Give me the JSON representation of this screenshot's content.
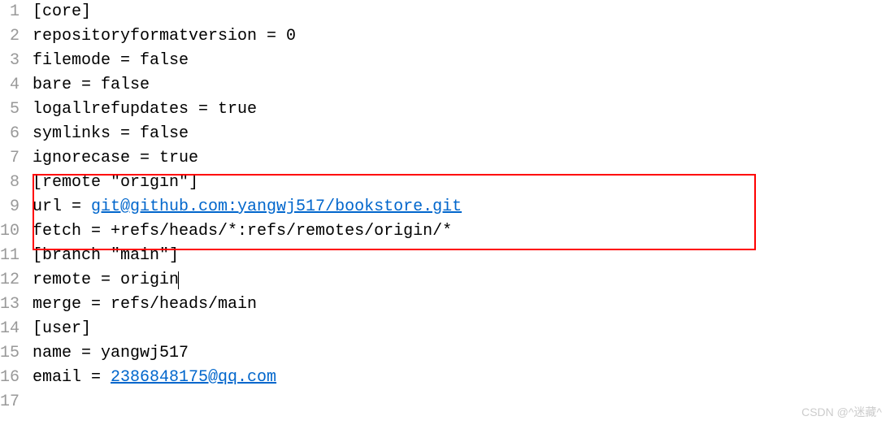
{
  "lines": [
    {
      "num": "1",
      "indent": "",
      "text": "[core]"
    },
    {
      "num": "2",
      "indent": "        ",
      "text": "repositoryformatversion = 0"
    },
    {
      "num": "3",
      "indent": "        ",
      "text": "filemode = false"
    },
    {
      "num": "4",
      "indent": "        ",
      "text": "bare = false"
    },
    {
      "num": "5",
      "indent": "        ",
      "text": "logallrefupdates = true"
    },
    {
      "num": "6",
      "indent": "        ",
      "text": "symlinks = false"
    },
    {
      "num": "7",
      "indent": "        ",
      "text": "ignorecase = true"
    },
    {
      "num": "8",
      "indent": "",
      "text": "[remote \"origin\"]"
    },
    {
      "num": "9",
      "indent": "        ",
      "prefix": "url = ",
      "link": "git@github.com:yangwj517/bookstore.git"
    },
    {
      "num": "10",
      "indent": "        ",
      "text": "fetch = +refs/heads/*:refs/remotes/origin/*"
    },
    {
      "num": "11",
      "indent": "",
      "text": "[branch \"main\"]"
    },
    {
      "num": "12",
      "indent": "        ",
      "text": "remote = origin",
      "cursor": true
    },
    {
      "num": "13",
      "indent": "        ",
      "text": "merge = refs/heads/main"
    },
    {
      "num": "14",
      "indent": "",
      "text": "[user]"
    },
    {
      "num": "15",
      "indent": "        ",
      "text": "name = yangwj517"
    },
    {
      "num": "16",
      "indent": "        ",
      "prefix": "email = ",
      "link": "2386848175@qq.com"
    },
    {
      "num": "17",
      "indent": "",
      "text": ""
    }
  ],
  "watermark": "CSDN @^迷藏^"
}
